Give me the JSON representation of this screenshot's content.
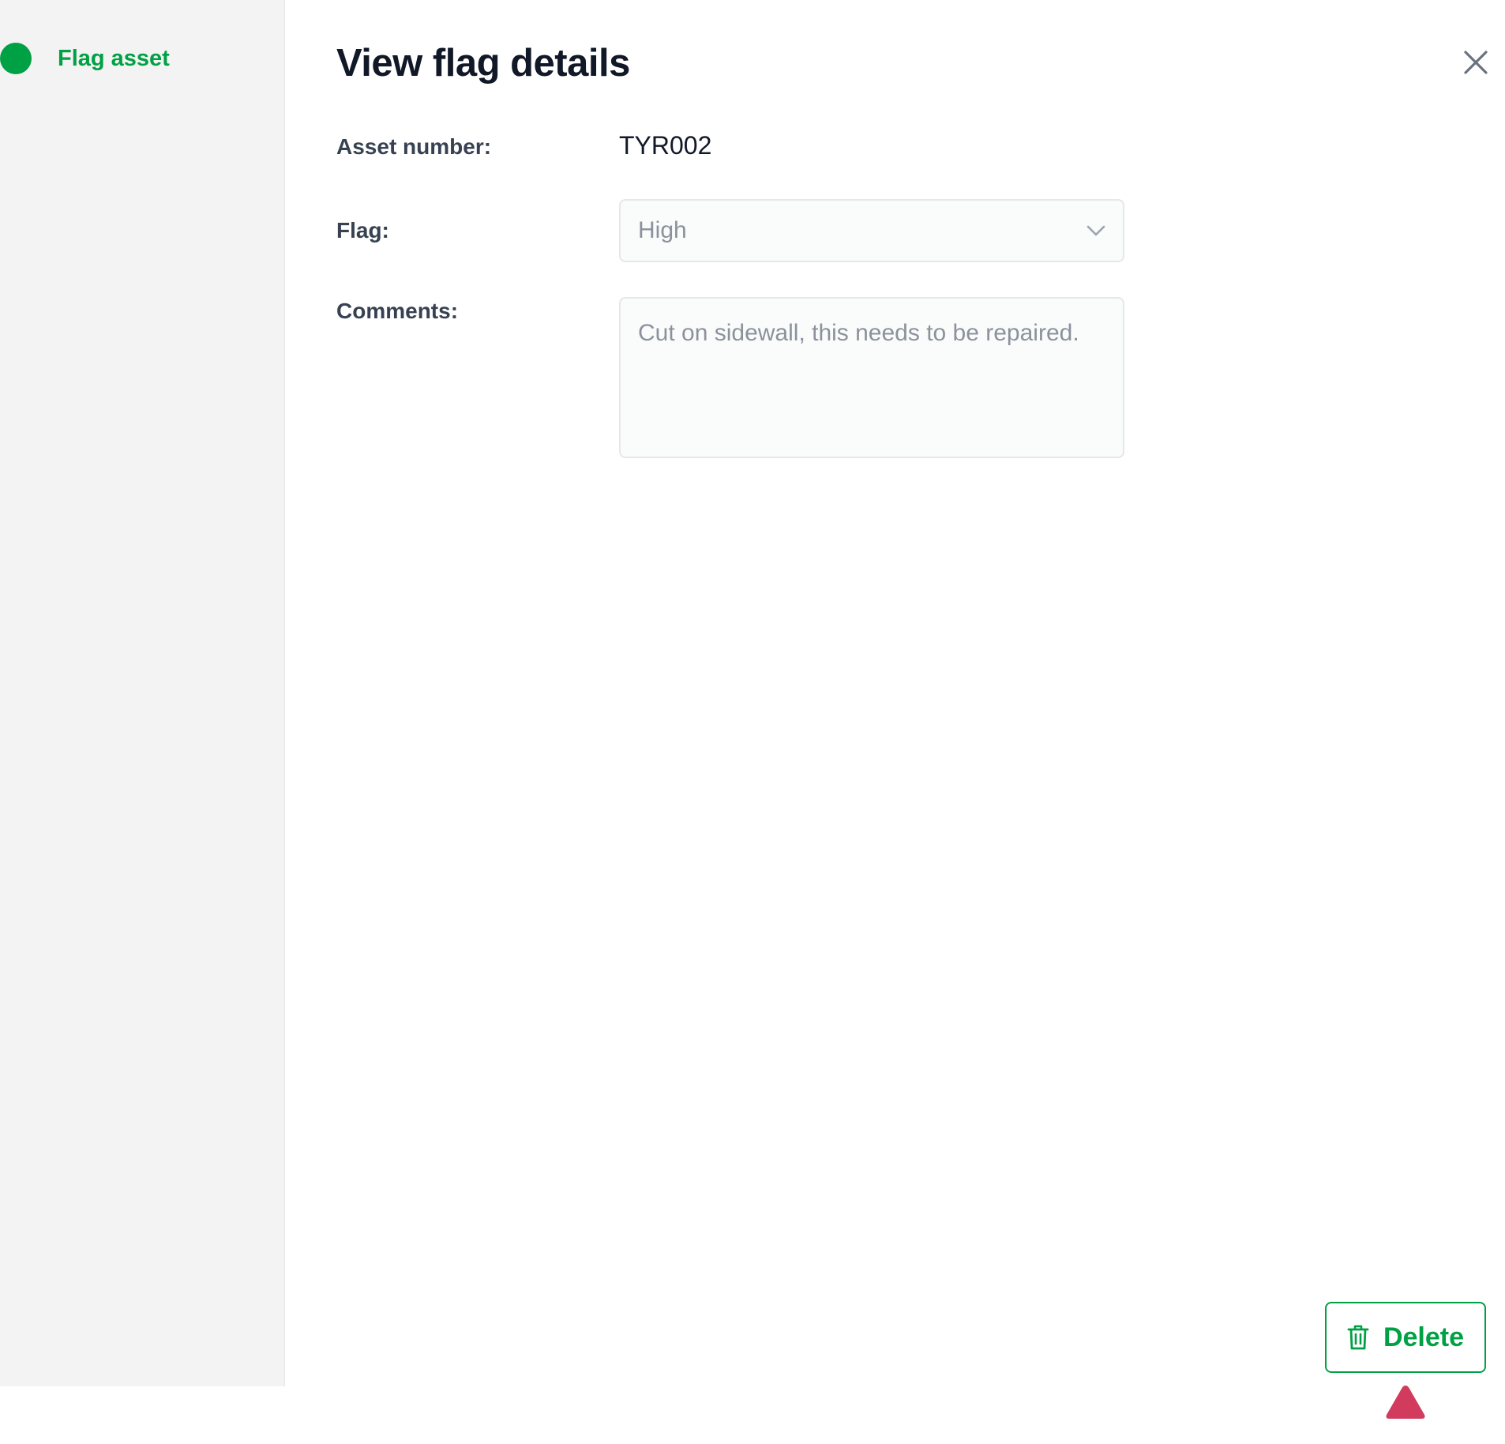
{
  "colors": {
    "accent": "#00a144",
    "marker": "#d13b5e"
  },
  "sidebar": {
    "step_label": "Flag asset",
    "step_status_icon": "filled-dot-icon"
  },
  "panel": {
    "title": "View flag details",
    "close_icon": "close-icon"
  },
  "form": {
    "asset_number_label": "Asset number:",
    "asset_number_value": "TYR002",
    "flag_label": "Flag:",
    "flag_value": "High",
    "flag_icon": "chevron-down-icon",
    "comments_label": "Comments:",
    "comments_value": "Cut on sidewall, this needs to be repaired."
  },
  "actions": {
    "delete_label": "Delete",
    "delete_icon": "trash-icon"
  },
  "overlay": {
    "pointer_icon": "pointer-triangle-icon"
  }
}
